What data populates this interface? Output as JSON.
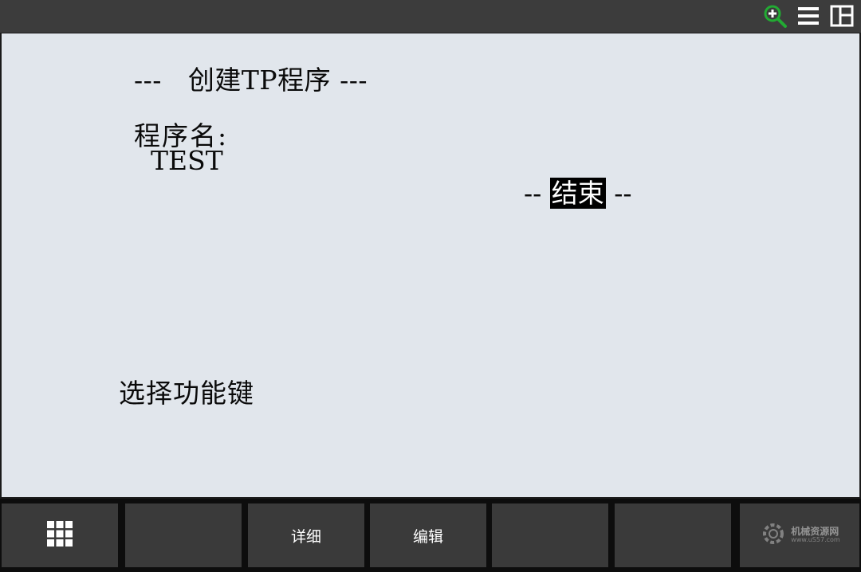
{
  "topbar": {
    "icons": [
      "zoom-in-icon",
      "menu-icon",
      "split-view-icon"
    ],
    "accent": "#22aa33"
  },
  "screen": {
    "title": "---   创建TP程序 ---",
    "program_label": "程序名:",
    "program_name": "TEST",
    "end_prefix": "-- ",
    "end_label": "结束",
    "end_suffix": " --",
    "prompt": "选择功能键"
  },
  "function_keys": {
    "f0_icon": "grid-icon",
    "f1": "",
    "f2": "详细",
    "f3": "编辑",
    "f4": "",
    "f5": "",
    "watermark": {
      "line1": "机械资源网",
      "line2": "www.uS57.com"
    }
  },
  "colors": {
    "screen_bg": "#e1e6ec",
    "bar_bg": "#3c3c3c",
    "key_bg": "#3a3a3a"
  }
}
